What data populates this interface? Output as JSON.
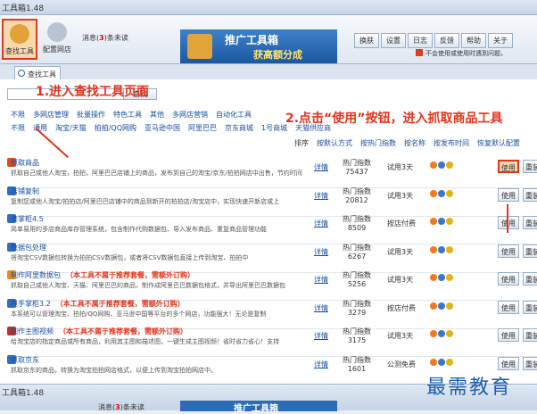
{
  "window": {
    "title": "工具箱1.48"
  },
  "toolbar": {
    "find_tool": "查找工具",
    "config_shop": "配置网店",
    "msg_prefix": "消息(",
    "msg_count": "3",
    "msg_suffix": ")条未读"
  },
  "banner": {
    "line1": "推广工具箱",
    "line2": "获高额分成"
  },
  "top_buttons": [
    "换肤",
    "设置",
    "日志",
    "反馈",
    "帮助",
    "关于"
  ],
  "warning": "不会使用或使用时遇到问题，",
  "tab": {
    "label": "查找工具"
  },
  "search": {
    "button": "查找"
  },
  "categories_row1": [
    "不限",
    "多网店管理",
    "批量操作",
    "特色工具",
    "其他",
    "多网店营销",
    "自动化工具"
  ],
  "categories_row2": [
    "不限",
    "通用",
    "淘宝/天猫",
    "拍拍/QQ网购",
    "亚马逊中国",
    "阿里巴巴",
    "京东商城",
    "1号商城",
    "天猫供应商"
  ],
  "sort": {
    "label": "排序",
    "items": [
      "按默认方式",
      "按热门指数",
      "按名称",
      "按发布时间",
      "恢复默认配置"
    ]
  },
  "annotations": {
    "step1": "1.进入查找工具页面",
    "step2": "2.点击“使用”按钮，进入抓取商品工具"
  },
  "rows": [
    {
      "name": "抓取商品",
      "note": "",
      "desc": "抓取自己或他人淘宝，拍拍，阿里巴巴店铺上的商品，发布到自己的淘宝/京东/拍拍网店中出售，节约时间",
      "hot_label": "热门指数",
      "hot": "75437",
      "trial": "试用3天",
      "use": "使用",
      "re": "重装",
      "color": "#e04a20"
    },
    {
      "name": "店铺复制",
      "note": "",
      "desc": "复制您或他人淘宝/拍拍店/阿里巴巴店铺中的商品到新开的拍拍店/淘宝店中，实现快速开新店或上",
      "hot_label": "热门指数",
      "hot": "20812",
      "trial": "试用3天",
      "use": "使用",
      "re": "重装",
      "color": "#2f6fc0"
    },
    {
      "name": "表掌柜4.5",
      "note": "",
      "desc": "简单易用的多店商品库存管理系统，包含制作代购数据包、导入发布商品、重复商品管理功能",
      "hot_label": "热门指数",
      "hot": "8509",
      "trial": "按店付费",
      "use": "使用",
      "re": "重装",
      "color": "#2f6fc0"
    },
    {
      "name": "数据包处理",
      "note": "",
      "desc": "将淘宝CSV数据包转换为拍拍CSV数据包，或者将CSV数据包直接上传到淘宝、拍拍中",
      "hot_label": "热门指数",
      "hot": "6267",
      "trial": "试用3天",
      "use": "使用",
      "re": "重装",
      "color": "#2f6fc0"
    },
    {
      "name": "制作阿里数据包",
      "note": "（本工具不属于推荐套餐，需额外订购）",
      "desc": "抓取自己或他人淘宝、天猫、阿里巴巴的商品，制作成阿里巴巴数据包格式，并导出阿里巴巴数据包",
      "hot_label": "热门指数",
      "hot": "5256",
      "trial": "试用3天",
      "use": "使用",
      "re": "重装",
      "color": "#e58a1c"
    },
    {
      "name": "甩手掌柜3.2",
      "note": "（本工具不属于推荐套餐，需额外订购）",
      "desc": "本系统可以管理淘宝、拍拍/QQ网购、亚马逊中国等平台的多个网店，功能强大！无论是复制",
      "hot_label": "热门指数",
      "hot": "3279",
      "trial": "按店付费",
      "use": "使用",
      "re": "重装",
      "color": "#2f6fc0"
    },
    {
      "name": "制作主图视频",
      "note": "（本工具不属于推荐套餐，需额外订购）",
      "desc": "给淘宝店的指定商品或所有商品，利用其主图和描述图，一键生成主图视频！省时省力省心！支持",
      "hot_label": "热门指数",
      "hot": "3175",
      "trial": "试用3天",
      "use": "使用",
      "re": "重装",
      "color": "#c0302a"
    },
    {
      "name": "抓取京东",
      "note": "",
      "desc": "抓取京东的商品，转换为淘宝拍拍网店格式，以便上传到淘宝拍拍网店中。",
      "hot_label": "热门指数",
      "hot": "1601",
      "trial": "公测免费",
      "use": "使用",
      "re": "重装",
      "color": "#2f6fc0"
    }
  ],
  "detail_label": "详情",
  "watermark": "最需教育",
  "bottom": {
    "title": "工具箱1.48",
    "msg_prefix": "消息(",
    "msg_count": "3",
    "msg_suffix": ")条未读",
    "banner": "推广工具箱"
  }
}
